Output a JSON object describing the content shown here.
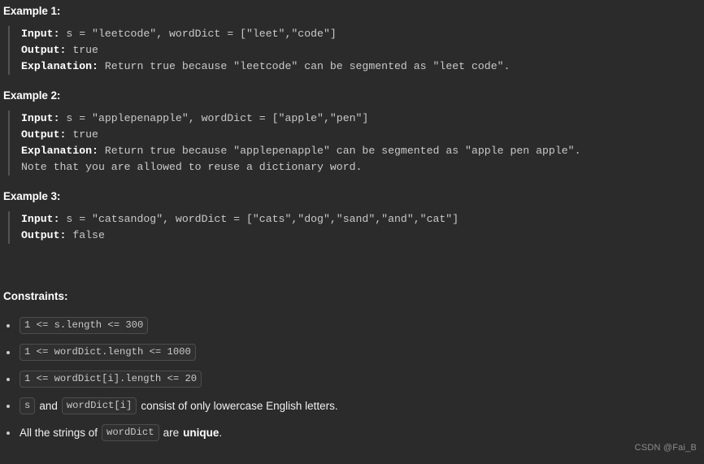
{
  "theme": {
    "background": "#2b2b2b",
    "text": "#f0f0f0",
    "code_text": "#c9c9c9",
    "pill_bg": "#303030",
    "pill_border": "#4d4d4d",
    "blockquote_border": "#555555",
    "watermark": "#8c8c8c"
  },
  "examples": [
    {
      "heading": "Example 1:",
      "input_label": "Input:",
      "input_value": " s = \"leetcode\", wordDict = [\"leet\",\"code\"]",
      "output_label": "Output:",
      "output_value": " true",
      "explanation_label": "Explanation:",
      "explanation_value": " Return true because \"leetcode\" can be segmented as \"leet code\".",
      "note": ""
    },
    {
      "heading": "Example 2:",
      "input_label": "Input:",
      "input_value": " s = \"applepenapple\", wordDict = [\"apple\",\"pen\"]",
      "output_label": "Output:",
      "output_value": " true",
      "explanation_label": "Explanation:",
      "explanation_value": " Return true because \"applepenapple\" can be segmented as \"apple pen apple\".",
      "note": "Note that you are allowed to reuse a dictionary word."
    },
    {
      "heading": "Example 3:",
      "input_label": "Input:",
      "input_value": " s = \"catsandog\", wordDict = [\"cats\",\"dog\",\"sand\",\"and\",\"cat\"]",
      "output_label": "Output:",
      "output_value": " false",
      "explanation_label": "",
      "explanation_value": "",
      "note": ""
    }
  ],
  "constraints": {
    "heading": "Constraints:",
    "items": [
      {
        "code1": "1 <= s.length <= 300",
        "text1": "",
        "code2": "",
        "text2": "",
        "bold": "",
        "text3": ""
      },
      {
        "code1": "1 <= wordDict.length <= 1000",
        "text1": "",
        "code2": "",
        "text2": "",
        "bold": "",
        "text3": ""
      },
      {
        "code1": "1 <= wordDict[i].length <= 20",
        "text1": "",
        "code2": "",
        "text2": "",
        "bold": "",
        "text3": ""
      },
      {
        "code1": "s",
        "text1": "and",
        "code2": "wordDict[i]",
        "text2": "consist of only lowercase English letters.",
        "bold": "",
        "text3": ""
      },
      {
        "code1": "",
        "text1": "All the strings of",
        "code2": "wordDict",
        "text2": "are",
        "bold": "unique",
        "text3": "."
      }
    ]
  },
  "watermark": "CSDN @Fai_B"
}
